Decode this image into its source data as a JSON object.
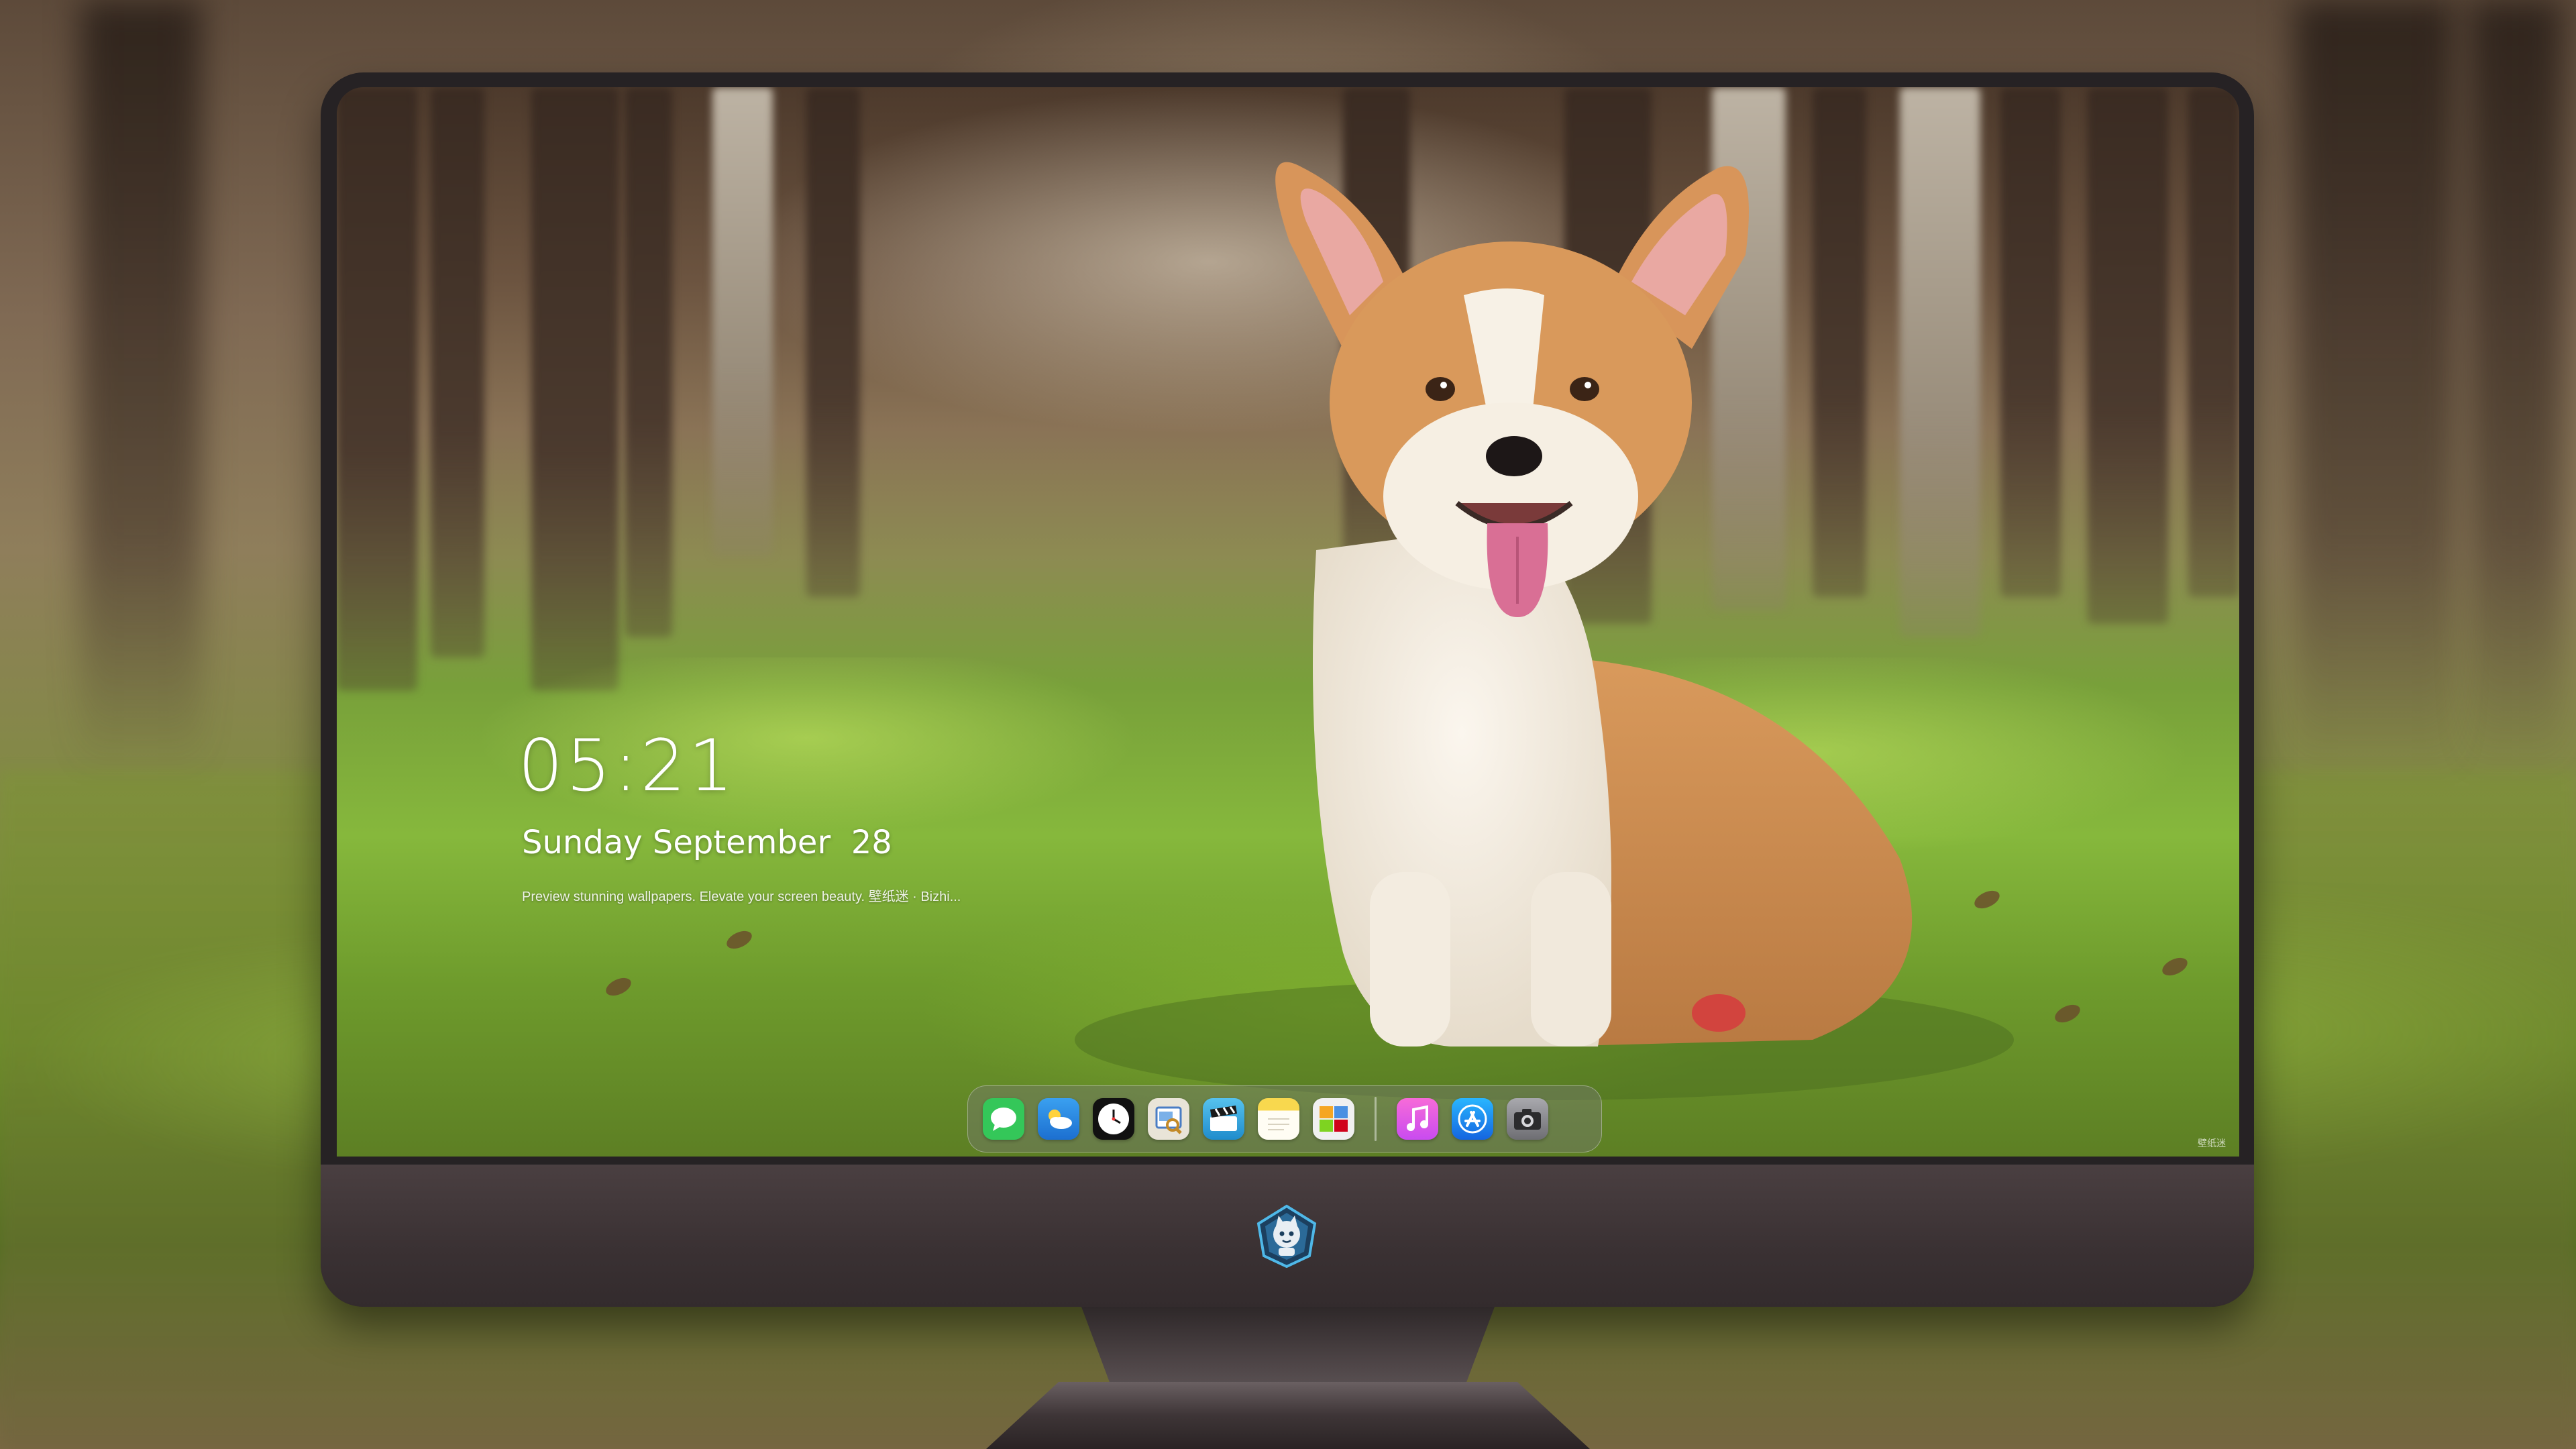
{
  "lockscreen": {
    "time": "05:21",
    "date": "Sunday September  28",
    "tagline": "Preview stunning wallpapers. Elevate your screen beauty. 壁纸迷 · Bizhi...",
    "corner_mark": "壁纸迷"
  },
  "dock": {
    "apps": [
      {
        "name": "messages-icon",
        "color": "#34c759"
      },
      {
        "name": "weather-icon",
        "color": "#2f8bea"
      },
      {
        "name": "clock-icon",
        "color": "#111111"
      },
      {
        "name": "preview-icon",
        "color": "#e9e4d8"
      },
      {
        "name": "claquette-icon",
        "color": "#2a9fd8"
      },
      {
        "name": "notes-icon",
        "color": "#f6d24a"
      },
      {
        "name": "photo-gallery-icon",
        "color": "#f0f0f0"
      },
      {
        "name": "music-icon",
        "color": "#f05bd0"
      },
      {
        "name": "app-store-icon",
        "color": "#1a8cff"
      },
      {
        "name": "camera-icon",
        "color": "#8e8e93"
      }
    ]
  },
  "colors": {
    "bezel": "#262224",
    "chin": "#3a3133"
  }
}
